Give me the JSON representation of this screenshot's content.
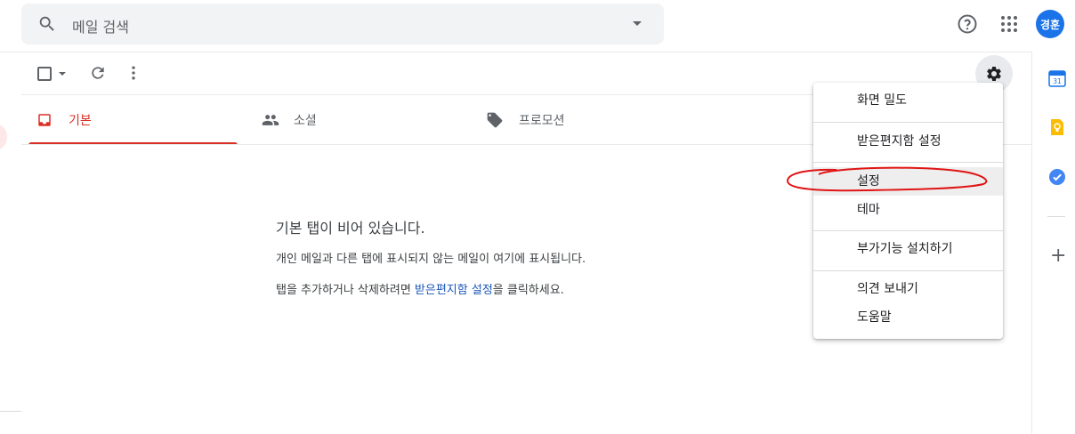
{
  "search": {
    "placeholder": "메일 검색"
  },
  "header": {
    "avatar_initials": "경훈",
    "accent_color": "#1a73e8"
  },
  "tabs": [
    {
      "label": "기본",
      "active": true
    },
    {
      "label": "소셜",
      "active": false
    },
    {
      "label": "프로모션",
      "active": false
    }
  ],
  "empty_state": {
    "title": "기본 탭이 비어 있습니다.",
    "line1": "개인 메일과 다른 탭에 표시되지 않는 메일이 여기에 표시됩니다.",
    "line2_before": "탭을 추가하거나 삭제하려면 ",
    "line2_link": "받은편지함 설정",
    "line2_after": "을 클릭하세요."
  },
  "settings_menu": {
    "items": [
      {
        "label": "화면 밀도"
      },
      {
        "label": "받은편지함 설정"
      },
      {
        "label": "설정",
        "highlighted": true
      },
      {
        "label": "테마"
      },
      {
        "label": "부가기능 설치하기"
      },
      {
        "label": "의견 보내기"
      },
      {
        "label": "도움말"
      }
    ]
  },
  "icons": {
    "search": "search-icon",
    "dropdown": "caret-down-icon",
    "help": "help-icon",
    "apps": "apps-grid-icon",
    "refresh": "refresh-icon",
    "more": "more-vert-icon",
    "settings": "gear-icon",
    "inbox": "inbox-icon",
    "social": "people-icon",
    "promotions": "tag-icon",
    "calendar": "calendar-icon",
    "keep": "keep-icon",
    "tasks": "tasks-icon",
    "add": "plus-icon"
  }
}
